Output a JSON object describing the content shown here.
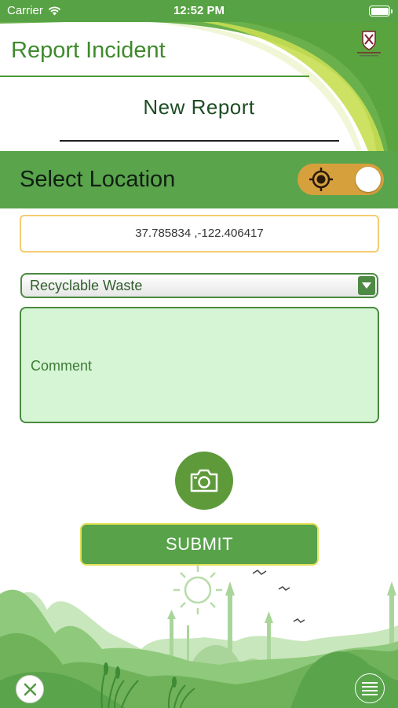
{
  "status_bar": {
    "carrier": "Carrier",
    "time": "12:52 PM",
    "wifi_icon": "wifi-icon",
    "battery_icon": "battery-icon"
  },
  "header": {
    "title": "Report Incident",
    "logo_icon": "shield-crest-icon"
  },
  "form": {
    "heading": "New Report",
    "location_label": "Select Location",
    "location_toggle_icon": "crosshair-target-icon",
    "location_toggle_on": true,
    "coordinates": "37.785834 ,-122.406417",
    "category_selected": "Recyclable Waste",
    "comment_placeholder": "Comment",
    "camera_icon": "camera-icon",
    "submit_label": "SUBMIT"
  },
  "footer": {
    "close_icon": "close-icon",
    "menu_icon": "menu-icon"
  },
  "colors": {
    "primary_green": "#5aa44c",
    "dark_green": "#3e8a2c",
    "toggle_orange": "#d6a03d",
    "comment_bg": "#d5f5d5",
    "coords_border": "#f3cc72"
  }
}
